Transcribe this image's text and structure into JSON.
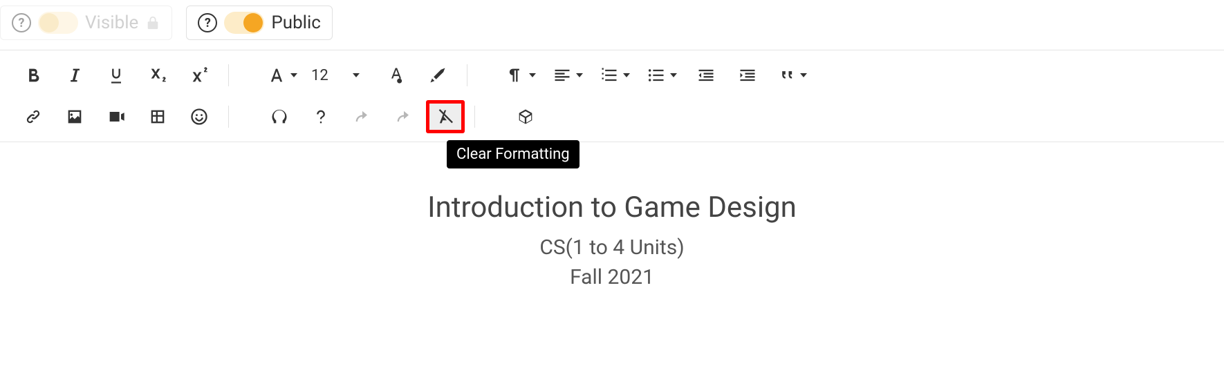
{
  "header": {
    "visible_label": "Visible",
    "public_label": "Public"
  },
  "toolbar": {
    "font_size": "12",
    "tooltip": "Clear Formatting"
  },
  "content": {
    "title": "Introduction to Game Design",
    "subtitle": "CS(1 to 4 Units)",
    "term": "Fall 2021"
  }
}
